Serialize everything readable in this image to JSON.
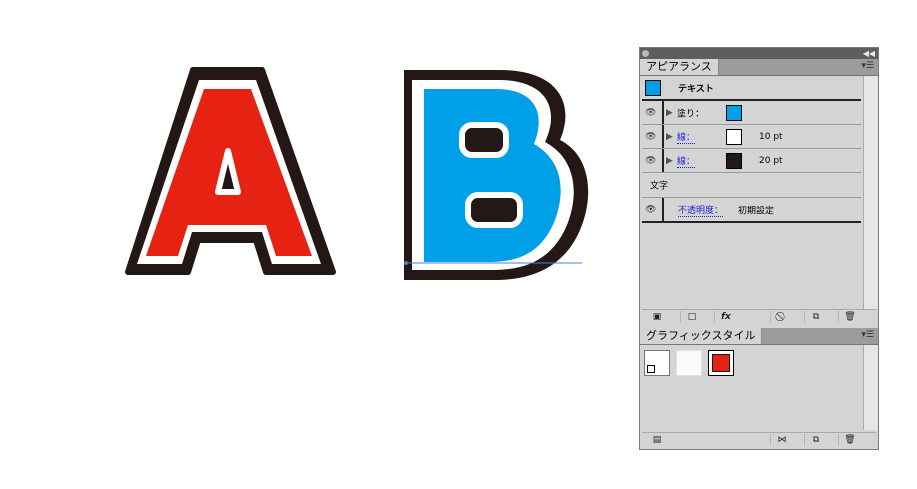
{
  "canvas": {
    "letters": [
      {
        "char": "A",
        "fill_color": "#e62212",
        "inner_stroke_color": "#ffffff",
        "outer_stroke_color": "#231815"
      },
      {
        "char": "B",
        "fill_color": "#00a0e9",
        "inner_stroke_color": "#ffffff",
        "outer_stroke_color": "#231815"
      }
    ],
    "baseline_color": "#4a7fd8"
  },
  "appearance_panel": {
    "tab_label": "アピアランス",
    "menu_icon": "panel-menu-icon",
    "header": {
      "label": "テキスト",
      "swatch_color": "#00a0e9"
    },
    "rows": [
      {
        "label": "塗り：",
        "swatch_color": "#00a0e9",
        "value": ""
      },
      {
        "label": "線：",
        "swatch_color": "#ffffff",
        "value": "10 pt"
      },
      {
        "label": "線：",
        "swatch_color": "#231815",
        "value": "20 pt"
      }
    ],
    "characters_label": "文字",
    "opacity": {
      "label": "不透明度：",
      "value": "初期設定"
    },
    "toolbar": {
      "new_stroke_icon": "add-new-stroke-icon",
      "new_fill_icon": "add-new-fill-icon",
      "fx_label": "fx",
      "clear_icon": "clear-appearance-icon",
      "duplicate_icon": "duplicate-item-icon",
      "delete_icon": "trash-icon"
    }
  },
  "graphic_styles_panel": {
    "tab_label": "グラフィックスタイル",
    "menu_icon": "panel-menu-icon",
    "styles": [
      {
        "name": "default-style",
        "color": "#ffffff"
      },
      {
        "name": "blank-style",
        "color": "#f2f2f2"
      },
      {
        "name": "red-style",
        "color": "#e62212"
      }
    ],
    "toolbar": {
      "library_icon": "graphic-style-library-icon",
      "break_link_icon": "break-link-icon",
      "new_icon": "new-graphic-style-icon",
      "delete_icon": "trash-icon"
    }
  }
}
